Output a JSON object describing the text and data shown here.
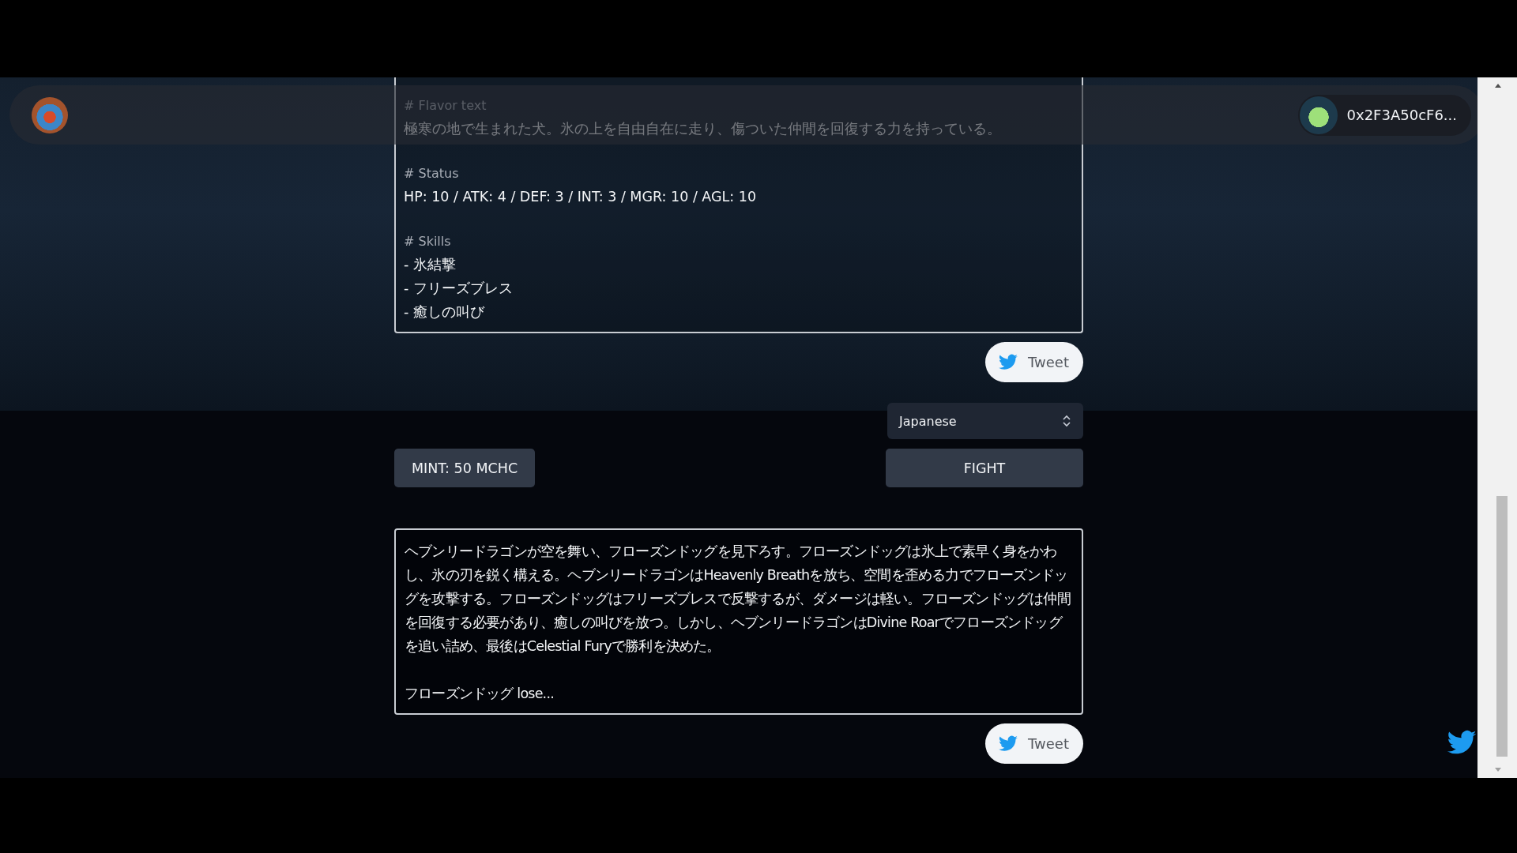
{
  "header": {
    "wallet": {
      "address": "0x2F3A50cF6..."
    }
  },
  "character_card": {
    "flavor_label": "# Flavor text",
    "flavor_text": "極寒の地で生まれた犬。氷の上を自由自在に走り、傷ついた仲間を回復する力を持っている。",
    "status_label": "# Status",
    "status": "HP: 10 / ATK: 4 / DEF: 3 / INT: 3 / MGR: 10 / AGL: 10",
    "skills_label": "# Skills",
    "skills": [
      "- 氷結撃",
      "- フリーズブレス",
      "- 癒しの叫び"
    ]
  },
  "tweet_button_1": {
    "label": "Tweet"
  },
  "language_select": {
    "value": "Japanese"
  },
  "mint_button": {
    "label": "MINT: 50 MCHC"
  },
  "fight_button": {
    "label": "FIGHT"
  },
  "battle_log": {
    "narrative": "ヘブンリードラゴンが空を舞い、フローズンドッグを見下ろす。フローズンドッグは氷上で素早く身をかわし、氷の刃を鋭く構える。ヘブンリードラゴンはHeavenly Breathを放ち、空間を歪める力でフローズンドッグを攻撃する。フローズンドッグはフリーズブレスで反撃するが、ダメージは軽い。フローズンドッグは仲間を回復する必要があり、癒しの叫びを放つ。しかし、ヘブンリードラゴンはDivine Roarでフローズンドッグを追い詰め、最後はCelestial Furyで勝利を決めた。",
    "result": "フローズンドッグ lose..."
  },
  "tweet_button_2": {
    "label": "Tweet"
  }
}
